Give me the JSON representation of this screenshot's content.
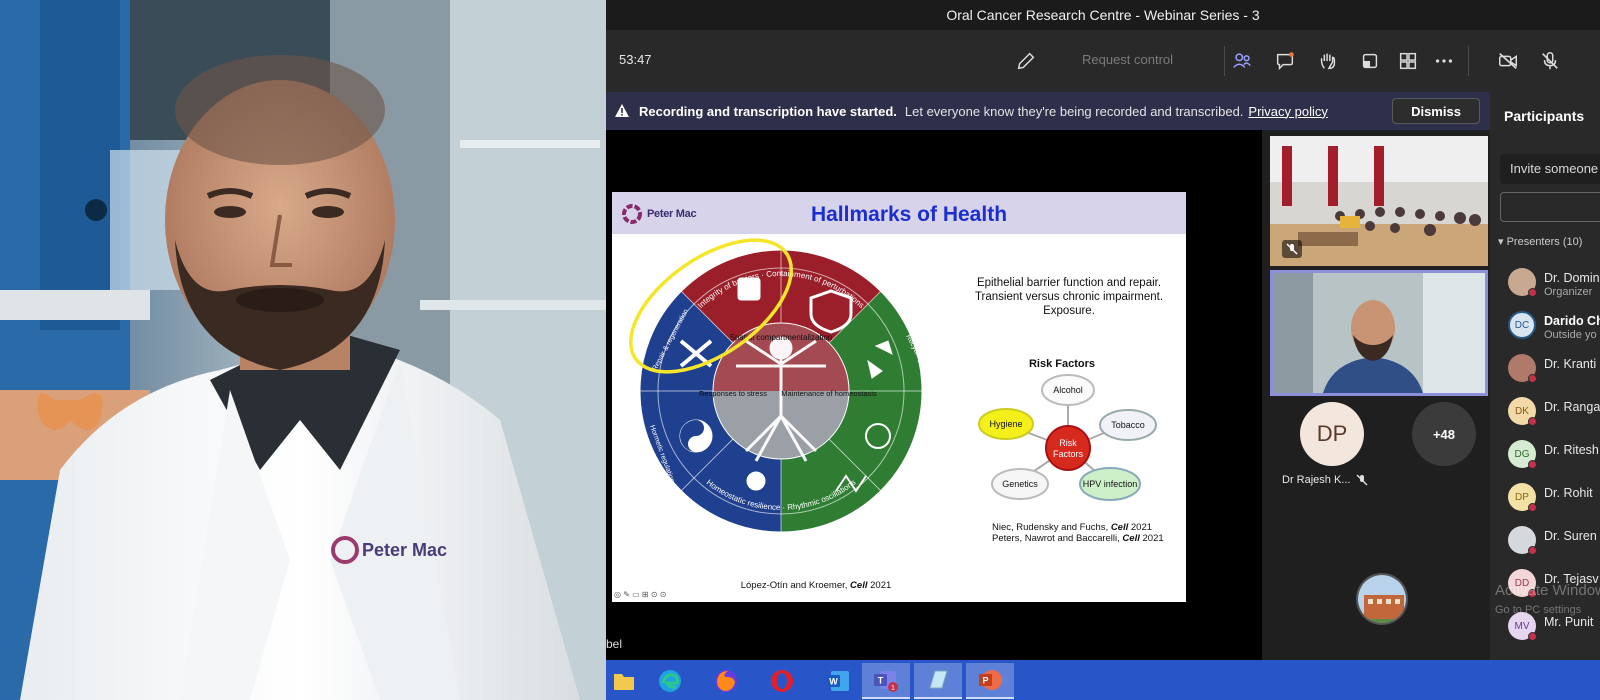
{
  "window": {
    "title": "Oral Cancer Research Centre - Webinar Series - 3"
  },
  "meeting": {
    "timer": "53:47",
    "request_control": "Request control",
    "icons": [
      "pencil-icon",
      "people-icon",
      "chat-icon",
      "raise-hand-icon",
      "share-tray-icon",
      "apps-icon",
      "more-icon",
      "camera-off-icon",
      "mic-off-icon"
    ]
  },
  "banner": {
    "bold": "Recording and transcription have started.",
    "text": "Let everyone know they're being recorded and transcribed.",
    "link": "Privacy policy",
    "dismiss": "Dismiss"
  },
  "slide": {
    "logo": "Peter Mac",
    "title": "Hallmarks of Health",
    "description": [
      "Epithelial barrier function and repair.",
      "Transient versus chronic impairment.",
      "Exposure."
    ],
    "risk_title": "Risk Factors",
    "risk_center": [
      "Risk",
      "Factors"
    ],
    "risk_nodes": [
      "Alcohol",
      "Tobacco",
      "HPV infection",
      "Genetics",
      "Hygiene"
    ],
    "references": [
      {
        "text": "Niec, Rudensky and Fuchs, ",
        "journal": "Cell",
        "year": " 2021"
      },
      {
        "text": "Peters, Nawrot and Baccarelli, ",
        "journal": "Cell",
        "year": " 2021"
      }
    ],
    "citation": {
      "text": "López-Otín and Kroemer, ",
      "journal": "Cell",
      "year": " 2021"
    },
    "wheel_outer": [
      "Integrity of barriers",
      "Containment of perturbations",
      "Recycling & turnover",
      "Integration of circuitries",
      "Rhythmic oscillations",
      "Homeostatic resilience",
      "Hormetic regulation",
      "Repair & regeneration"
    ],
    "wheel_inner": [
      "Spatial compartmentalization",
      "Responses to stress",
      "Maintenance of homeostasis"
    ]
  },
  "presenter_name_fragment": "bel",
  "gallery": {
    "dp_initials": "DP",
    "dp_name": "Dr Rajesh K...",
    "more_count": "+48"
  },
  "participants": {
    "title": "Participants",
    "invite_placeholder": "Invite someone",
    "presenters_label": "Presenters (10)",
    "people": [
      {
        "name": "Dr. Domin",
        "sub": "Organizer",
        "initials": "",
        "color": "#c8a890"
      },
      {
        "name": "Darido Ch",
        "sub": "Outside yo",
        "initials": "DC",
        "color": "#d8e4ee"
      },
      {
        "name": "Dr. Kranti",
        "sub": "",
        "initials": "",
        "color": "#b07a6a"
      },
      {
        "name": "Dr. Ranga",
        "sub": "",
        "initials": "DK",
        "color": "#f1d9a8"
      },
      {
        "name": "Dr. Ritesh",
        "sub": "",
        "initials": "DG",
        "color": "#d6ecd2"
      },
      {
        "name": "Dr. Rohit",
        "sub": "",
        "initials": "DP",
        "color": "#f3e1a6"
      },
      {
        "name": "Dr. Suren",
        "sub": "",
        "initials": "",
        "color": "#d5d9de"
      },
      {
        "name": "Dr. Tejasv",
        "sub": "",
        "initials": "DD",
        "color": "#f2d6d8"
      },
      {
        "name": "Mr. Punit",
        "sub": "",
        "initials": "MV",
        "color": "#e6d6f0"
      }
    ],
    "watermark_1": "Activate Windows",
    "watermark_2": "Go to PC settings"
  },
  "taskbar": {
    "items": [
      "file-explorer-icon",
      "edge-icon",
      "firefox-icon",
      "opera-icon",
      "word-icon",
      "teams-icon",
      "notes-icon",
      "powerpoint-icon"
    ],
    "teams_badge": "1"
  },
  "colors": {
    "accent": "#7f85f5",
    "banner": "#2e2f4a",
    "slide_title": "#1b2fd1",
    "taskbar": "#2856c9"
  }
}
